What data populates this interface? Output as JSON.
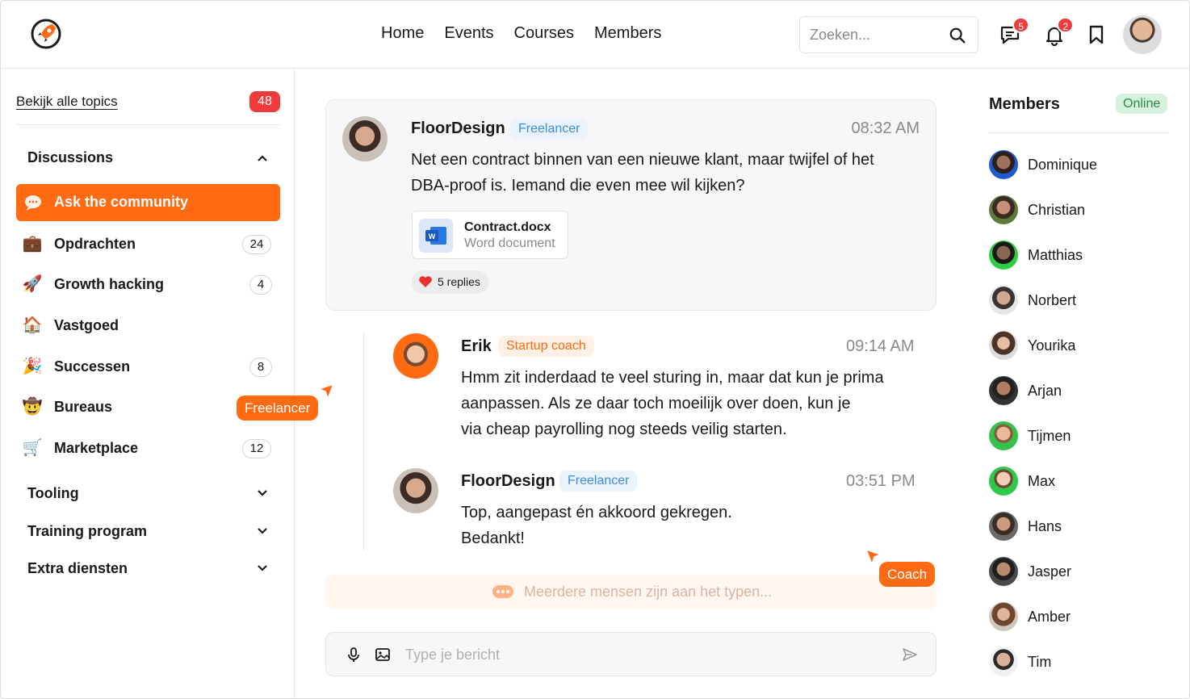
{
  "header": {
    "nav": [
      "Home",
      "Events",
      "Courses",
      "Members"
    ],
    "search_placeholder": "Zoeken...",
    "messages_badge": "5",
    "notifications_badge": "2"
  },
  "sidebar": {
    "all_topics": "Bekijk alle topics",
    "all_topics_count": "48",
    "discussions_label": "Discussions",
    "active_item": "Ask the community",
    "topics": [
      {
        "label": "Opdrachten",
        "count": "24",
        "emoji": "💼"
      },
      {
        "label": "Growth hacking",
        "count": "4",
        "emoji": "🚀"
      },
      {
        "label": "Vastgoed",
        "count": "",
        "emoji": "🏠"
      },
      {
        "label": "Successen",
        "count": "8",
        "emoji": "🎉"
      },
      {
        "label": "Bureaus",
        "count": "",
        "emoji": "🤠"
      },
      {
        "label": "Marketplace",
        "count": "12",
        "emoji": "🛒"
      }
    ],
    "sections": [
      "Tooling",
      "Training program",
      "Extra diensten"
    ]
  },
  "cursors": {
    "freelancer": "Freelancer",
    "coach": "Coach"
  },
  "post": {
    "author": "FloorDesign",
    "role": "Freelancer",
    "time": "08:32 AM",
    "line1": "Net een contract binnen van een nieuwe klant, maar twijfel of het",
    "line2": "DBA-proof is. Iemand die even mee wil kijken?",
    "file_name": "Contract.docx",
    "file_type": "Word document",
    "replies": "5 replies"
  },
  "reply1": {
    "author": "Erik",
    "role": "Startup coach",
    "time": "09:14 AM",
    "line1": "Hmm zit inderdaad te veel sturing in, maar dat kun je prima",
    "line2": "aanpassen. Als ze daar toch moeilijk over doen, kun je",
    "line3": "via cheap payrolling nog steeds veilig starten."
  },
  "reply2": {
    "author": "FloorDesign",
    "role": "Freelancer",
    "time": "03:51 PM",
    "line1": "Top, aangepast én akkoord gekregen.",
    "line2": "Bedankt!"
  },
  "typing": "Meerdere mensen zijn aan het typen...",
  "composer_placeholder": "Type je bericht",
  "members": {
    "title": "Members",
    "status": "Online",
    "list": [
      "Dominique",
      "Christian",
      "Matthias",
      "Norbert",
      "Yourika",
      "Arjan",
      "Tijmen",
      "Max",
      "Hans",
      "Jasper",
      "Amber",
      "Tim"
    ]
  },
  "colors": {
    "accent": "#ff6a13",
    "badge_red": "#ef3b3b",
    "freelancer_blue": "#3c8fdc",
    "online_green": "#2b8a45"
  }
}
